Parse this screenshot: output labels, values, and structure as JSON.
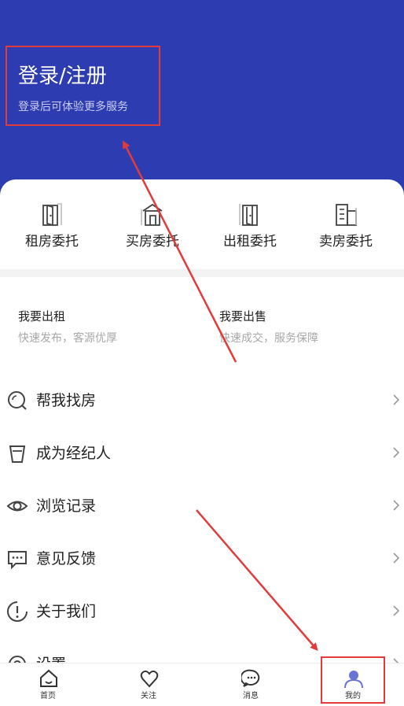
{
  "header": {
    "title": "登录/注册",
    "subtitle": "登录后可体验更多服务"
  },
  "quick_actions": [
    {
      "label": "租房委托",
      "icon": "door-building-icon"
    },
    {
      "label": "买房委托",
      "icon": "house-door-icon"
    },
    {
      "label": "出租委托",
      "icon": "door-building-icon"
    },
    {
      "label": "卖房委托",
      "icon": "buildings-icon"
    }
  ],
  "action_cards": [
    {
      "title": "我要出租",
      "subtitle": "快速发布，客源优厚"
    },
    {
      "title": "我要出售",
      "subtitle": "快速成交，服务保障"
    }
  ],
  "menu": [
    {
      "label": "帮我找房",
      "icon": "search-icon"
    },
    {
      "label": "成为经纪人",
      "icon": "agent-icon"
    },
    {
      "label": "浏览记录",
      "icon": "eye-icon"
    },
    {
      "label": "意见反馈",
      "icon": "feedback-icon"
    },
    {
      "label": "关于我们",
      "icon": "info-icon"
    },
    {
      "label": "设置",
      "icon": "settings-icon"
    }
  ],
  "tabbar": [
    {
      "label": "首页",
      "icon": "home-icon"
    },
    {
      "label": "关注",
      "icon": "heart-icon"
    },
    {
      "label": "消息",
      "icon": "message-icon"
    },
    {
      "label": "我的",
      "icon": "user-icon",
      "active": true
    }
  ],
  "colors": {
    "header_bg": "#2e3cb1",
    "annotation_red": "#e23b3b",
    "active_tab": "#6a74d6"
  }
}
